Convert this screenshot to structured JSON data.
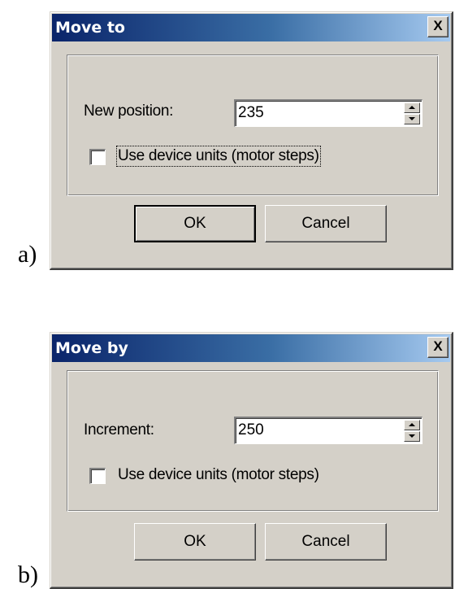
{
  "figure_labels": {
    "a": "a)",
    "b": "b)"
  },
  "dialogs": [
    {
      "title": "Move to",
      "close_glyph": "X",
      "field_label": "New position:",
      "field_value": "235",
      "checkbox_label": "Use device units (motor steps)",
      "checkbox_checked": false,
      "ok_label": "OK",
      "cancel_label": "Cancel"
    },
    {
      "title": "Move by",
      "close_glyph": "X",
      "field_label": "Increment:",
      "field_value": "250",
      "checkbox_label": "Use device units (motor steps)",
      "checkbox_checked": false,
      "ok_label": "OK",
      "cancel_label": "Cancel"
    }
  ],
  "colors": {
    "dialog_face": "#d4d0c8",
    "titlebar_start": "#0a246a",
    "titlebar_end": "#a6caf0",
    "title_text": "#ffffff"
  },
  "icons": [
    "close-icon",
    "spin-up-icon",
    "spin-down-icon"
  ]
}
